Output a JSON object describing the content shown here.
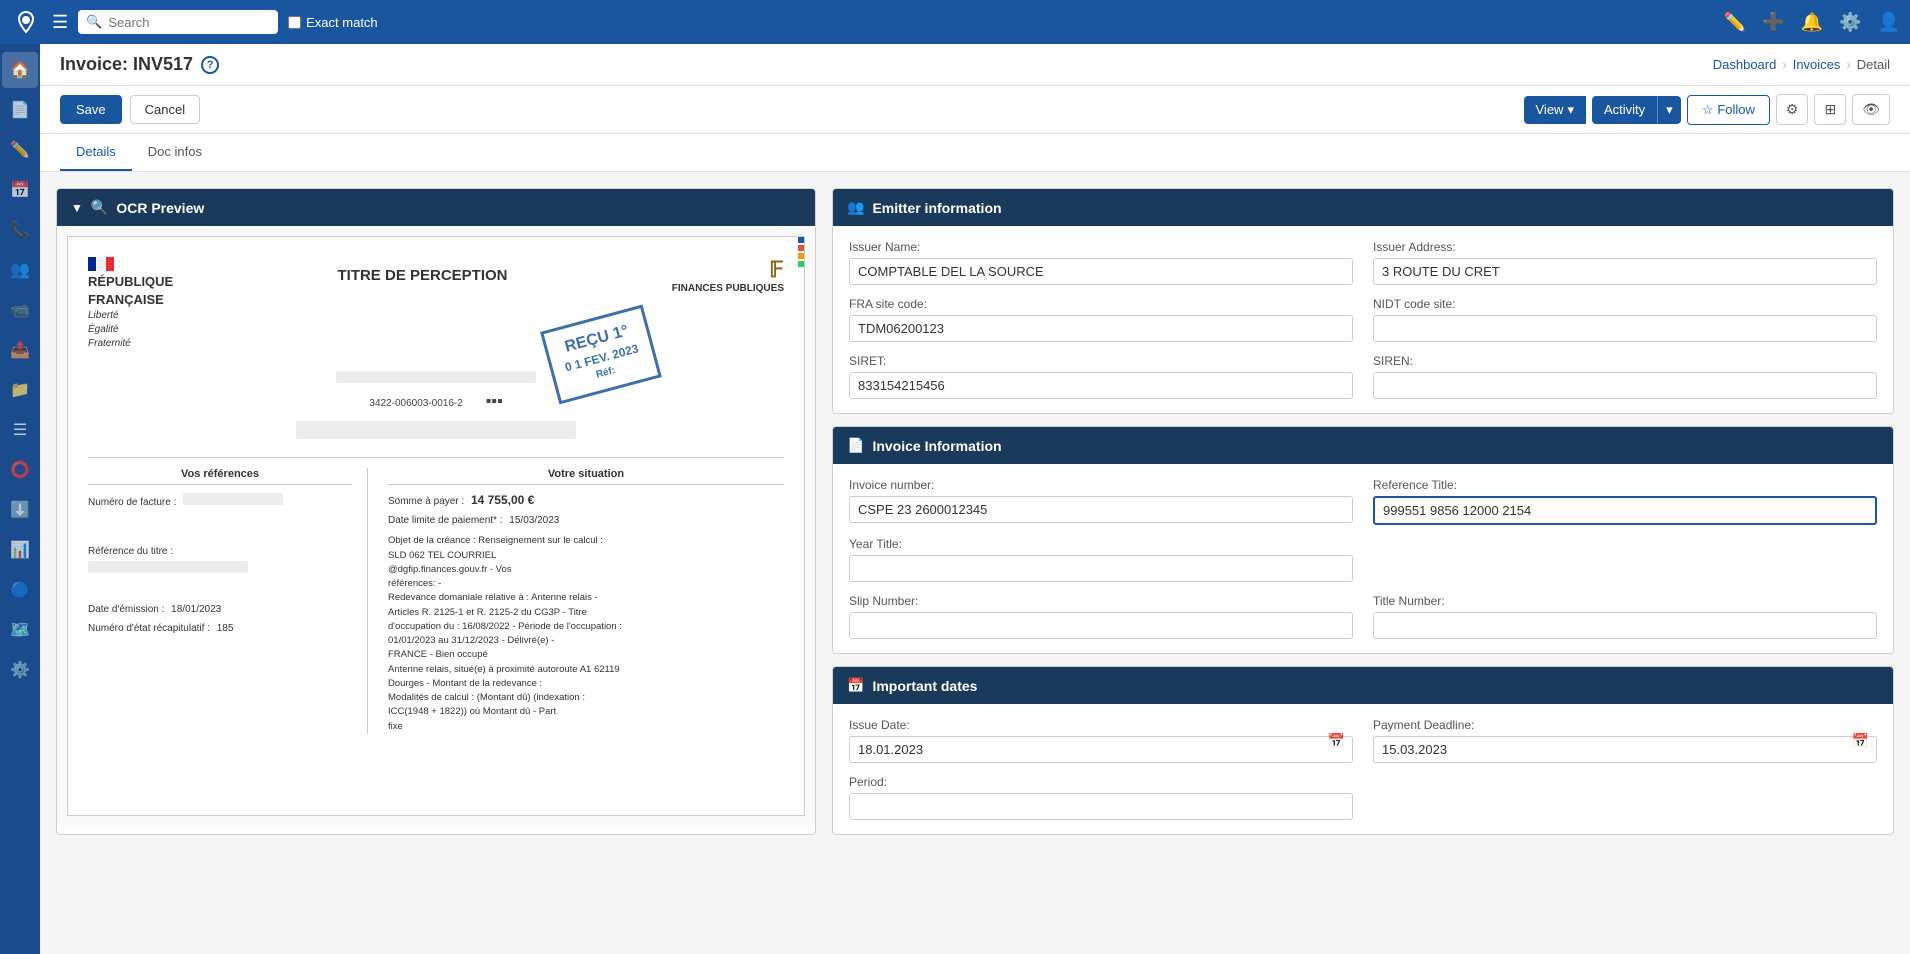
{
  "topNav": {
    "searchPlaceholder": "Search",
    "exactMatchLabel": "Exact match"
  },
  "pageHeader": {
    "title": "Invoice: INV517",
    "helpTooltip": "?",
    "breadcrumb": {
      "dashboard": "Dashboard",
      "invoices": "Invoices",
      "current": "Detail"
    }
  },
  "toolbar": {
    "saveLabel": "Save",
    "cancelLabel": "Cancel",
    "viewLabel": "View",
    "activityLabel": "Activity",
    "followLabel": "Follow"
  },
  "tabs": [
    {
      "label": "Details",
      "active": true
    },
    {
      "label": "Doc infos",
      "active": false
    }
  ],
  "ocrPanel": {
    "title": "OCR Preview",
    "document": {
      "republic": "RÉPUBLIQUE\nFRANÇAISE",
      "subtitle": "Liberté\nÉgalité\nFraternité",
      "titleCenter": "TITRE DE PERCEPTION",
      "stampText": "REÇU 1°",
      "stampDate": "0 1 FEV. 2023",
      "stampRef": "Réf:",
      "barcodeRef": "3422-006003-0016-2",
      "sections": {
        "vosRefs": "Vos références",
        "votreSituation": "Votre situation"
      },
      "rows": {
        "numeroFacture": "Numéro de facture :",
        "referenceTitle": "Référence du titre :",
        "dateEmission": "Date d'émission :",
        "dateEmissionValue": "18/01/2023",
        "numeroEtat": "Numéro d'état récapitulatif :",
        "numeroEtatValue": "185",
        "sommeAPayer": "Somme à payer :",
        "sommeValue": "14 755,00 €",
        "dateLimite": "Date limite de paiement* :",
        "dateLimiteValue": "15/03/2023",
        "objetCreance": "Objet de la créance : Renseignement sur le calcul :\nSLD 062 TEL COURRIEL\n@dgfip.finances.gouv.fr - Vos\nréférences: -\nRedevance domaniale relative à : Antenne relais -\nArticles R. 2125-1 et R. 2125-2 du CG3P - Titre\nd'occupation du : 16/08/2022 - Période de l'occupation :\n01/01/2023 au 31/12/2023 - Délivré(e) -\nFRANCE - Bien occupé\nAntenne relais, situé(e) à proximité autoroute A1 62119\nDourges - Montant de la redevance :\nModalités de calcul : (Montant dû) (indexation :\nICC(1948 + 1822)) où Montant dû - Part\nfixe"
      }
    }
  },
  "emitterInfo": {
    "title": "Emitter information",
    "fields": {
      "issuerName": {
        "label": "Issuer Name:",
        "value": "COMPTABLE DEL LA SOURCE"
      },
      "issuerAddress": {
        "label": "Issuer Address:",
        "value": "3 ROUTE DU CRET"
      },
      "fraSiteCode": {
        "label": "FRA site code:",
        "value": "TDM06200123"
      },
      "nidtCodeSite": {
        "label": "NIDT code site:",
        "value": ""
      },
      "siret": {
        "label": "SIRET:",
        "value": "833154215456"
      },
      "siren": {
        "label": "SIREN:",
        "value": ""
      }
    }
  },
  "invoiceInfo": {
    "title": "Invoice Information",
    "fields": {
      "invoiceNumber": {
        "label": "Invoice number:",
        "value": "CSPE 23 2600012345"
      },
      "referenceTitle": {
        "label": "Reference Title:",
        "value": "999551 9856 12000 2154"
      },
      "yearTitle": {
        "label": "Year Title:",
        "value": ""
      },
      "slipNumber": {
        "label": "Slip Number:",
        "value": ""
      },
      "titleNumber": {
        "label": "Title Number:",
        "value": ""
      }
    }
  },
  "importantDates": {
    "title": "Important dates",
    "fields": {
      "issueDate": {
        "label": "Issue Date:",
        "value": "18.01.2023"
      },
      "paymentDeadline": {
        "label": "Payment Deadline:",
        "value": "15.03.2023"
      },
      "period": {
        "label": "Period:",
        "value": ""
      }
    }
  },
  "sidebarIcons": [
    "home-icon",
    "document-icon",
    "edit-icon",
    "calendar-icon",
    "phone-icon",
    "users-icon",
    "video-icon",
    "send-icon",
    "folder-icon",
    "list-icon",
    "circle-icon",
    "download-icon",
    "chart-icon",
    "circle2-icon",
    "map-icon",
    "settings2-icon"
  ]
}
